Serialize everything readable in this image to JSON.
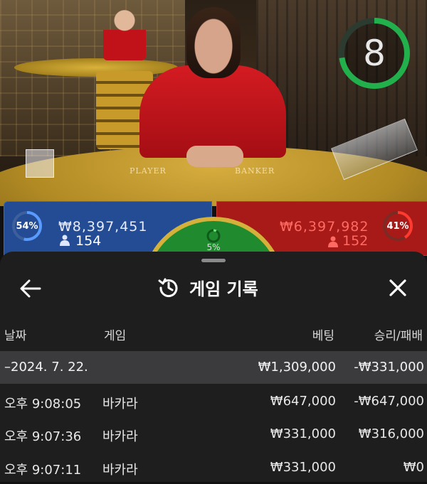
{
  "timer": {
    "value": "8",
    "color": "#21b04b"
  },
  "table_labels": {
    "player": "PLAYER",
    "banker": "BANKER"
  },
  "bets": {
    "player": {
      "percent": "54%",
      "amount": "₩8,397,451",
      "count": "154",
      "color": "#234c94"
    },
    "banker": {
      "percent": "41%",
      "amount": "₩6,397,982",
      "count": "152",
      "color": "#a81a18"
    },
    "tie": {
      "percent": "5%",
      "color": "#1f8a2e"
    }
  },
  "history": {
    "title": "게임 기록",
    "icons": {
      "back": "arrow-left-icon",
      "title": "history-icon",
      "close": "close-icon"
    },
    "columns": {
      "date": "날짜",
      "game": "게임",
      "bet": "베팅",
      "win_loss": "승리/패배"
    },
    "date_group": {
      "date": "–2024. 7. 22.",
      "bet": "₩1,309,000",
      "win_loss": "-₩331,000"
    },
    "rows": [
      {
        "time": "오후 9:08:05",
        "game": "바카라",
        "bet": "₩647,000",
        "win_loss": "-₩647,000"
      },
      {
        "time": "오후 9:07:36",
        "game": "바카라",
        "bet": "₩331,000",
        "win_loss": "₩316,000"
      },
      {
        "time": "오후 9:07:11",
        "game": "바카라",
        "bet": "₩331,000",
        "win_loss": "₩0"
      }
    ]
  }
}
